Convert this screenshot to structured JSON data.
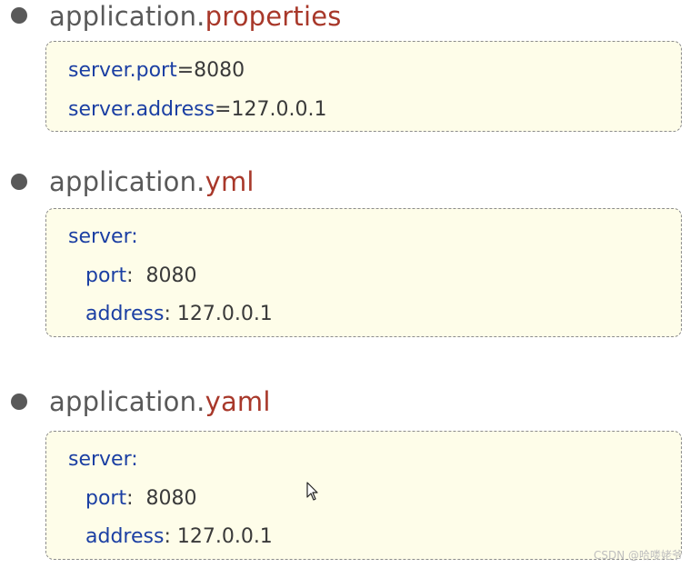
{
  "sections": [
    {
      "filename_base": "application.",
      "filename_ext": "properties",
      "lines": [
        {
          "key": "server.port",
          "sep": "=",
          "value": "8080"
        },
        {
          "key": "server.address",
          "sep": "=",
          "value": "127.0.0.1"
        }
      ]
    },
    {
      "filename_base": "application.",
      "filename_ext": "yml",
      "lines": [
        {
          "key": "server:",
          "sep": "",
          "value": ""
        },
        {
          "key": "port",
          "sep": ":  ",
          "value": "8080"
        },
        {
          "key": "address",
          "sep": ": ",
          "value": "127.0.0.1"
        }
      ]
    },
    {
      "filename_base": "application.",
      "filename_ext": "yaml",
      "lines": [
        {
          "key": "server:",
          "sep": "",
          "value": ""
        },
        {
          "key": "port",
          "sep": ":  ",
          "value": "8080"
        },
        {
          "key": "address",
          "sep": ": ",
          "value": "127.0.0.1"
        }
      ]
    }
  ],
  "watermark": "CSDN @哈喽姥爷",
  "colors": {
    "key": "#1b3fa3",
    "extension": "#a8382a",
    "filename": "#595959",
    "box_background": "#fefde9"
  },
  "icons": {
    "cursor": "mouse-pointer-icon",
    "bullet": "bullet-dot-icon"
  }
}
